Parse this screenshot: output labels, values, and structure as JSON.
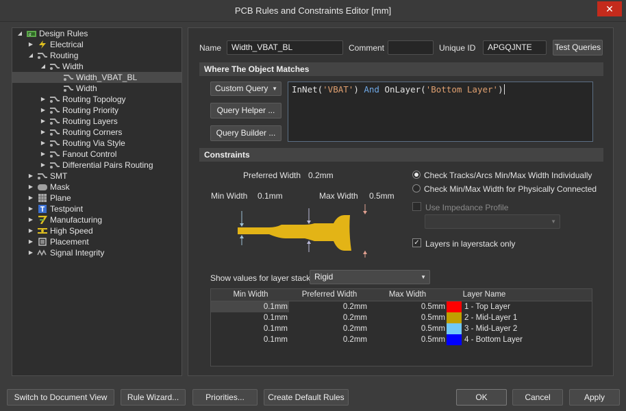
{
  "window": {
    "title": "PCB Rules and Constraints Editor [mm]"
  },
  "tree": {
    "items": [
      {
        "label": "Design Rules",
        "icon": "design-rules-icon"
      },
      {
        "label": "Electrical",
        "icon": "electrical-icon"
      },
      {
        "label": "Routing",
        "icon": "routing-icon"
      },
      {
        "label": "Width",
        "icon": "routing-icon"
      },
      {
        "label": "Width_VBAT_BL",
        "icon": "rule-icon"
      },
      {
        "label": "Width",
        "icon": "rule-icon"
      },
      {
        "label": "Routing Topology",
        "icon": "routing-icon"
      },
      {
        "label": "Routing Priority",
        "icon": "routing-icon"
      },
      {
        "label": "Routing Layers",
        "icon": "routing-icon"
      },
      {
        "label": "Routing Corners",
        "icon": "routing-icon"
      },
      {
        "label": "Routing Via Style",
        "icon": "routing-icon"
      },
      {
        "label": "Fanout Control",
        "icon": "routing-icon"
      },
      {
        "label": "Differential Pairs Routing",
        "icon": "routing-icon"
      },
      {
        "label": "SMT",
        "icon": "smt-icon"
      },
      {
        "label": "Mask",
        "icon": "mask-icon"
      },
      {
        "label": "Plane",
        "icon": "plane-icon"
      },
      {
        "label": "Testpoint",
        "icon": "testpoint-icon"
      },
      {
        "label": "Manufacturing",
        "icon": "manufacturing-icon"
      },
      {
        "label": "High Speed",
        "icon": "high-speed-icon"
      },
      {
        "label": "Placement",
        "icon": "placement-icon"
      },
      {
        "label": "Signal Integrity",
        "icon": "signal-integrity-icon"
      }
    ]
  },
  "rule": {
    "name_label": "Name",
    "name_value": "Width_VBAT_BL",
    "comment_label": "Comment",
    "comment_value": "",
    "uid_label": "Unique ID",
    "uid_value": "APGQJNTE",
    "test_queries": "Test Queries"
  },
  "match": {
    "header": "Where The Object Matches",
    "query_type": "Custom Query",
    "query_helper": "Query Helper ...",
    "query_builder": "Query Builder ...",
    "query_tokens": {
      "t1": "InNet(",
      "t2": "'VBAT'",
      "t3": ")",
      "t4": "And",
      "t5": "OnLayer(",
      "t6": "'Bottom Layer'",
      "t7": ")"
    }
  },
  "constraints": {
    "header": "Constraints",
    "preferred_width_label": "Preferred Width",
    "preferred_width_value": "0.2mm",
    "min_width_label": "Min Width",
    "min_width_value": "0.1mm",
    "max_width_label": "Max Width",
    "max_width_value": "0.5mm",
    "radio_individual": "Check Tracks/Arcs Min/Max Width Individually",
    "radio_connected": "Check Min/Max Width for Physically Connected",
    "use_impedance": "Use Impedance Profile",
    "layers_only": "Layers in layerstack only",
    "show_values_label": "Show values for layer stack",
    "layer_stack_value": "Rigid"
  },
  "grid": {
    "headers": [
      "Min Width",
      "Preferred Width",
      "Max Width",
      "Layer Name"
    ],
    "rows": [
      {
        "min": "0.1mm",
        "pref": "0.2mm",
        "max": "0.5mm",
        "layer": "1 - Top Layer",
        "color": "#ff0000"
      },
      {
        "min": "0.1mm",
        "pref": "0.2mm",
        "max": "0.5mm",
        "layer": "2 - Mid-Layer 1",
        "color": "#c0a000"
      },
      {
        "min": "0.1mm",
        "pref": "0.2mm",
        "max": "0.5mm",
        "layer": "3 - Mid-Layer 2",
        "color": "#70c8f8"
      },
      {
        "min": "0.1mm",
        "pref": "0.2mm",
        "max": "0.5mm",
        "layer": "4 - Bottom Layer",
        "color": "#0000ff"
      }
    ]
  },
  "footer": {
    "switch": "Switch to Document View",
    "wizard": "Rule Wizard...",
    "priorities": "Priorities...",
    "create_default": "Create Default Rules",
    "ok": "OK",
    "cancel": "Cancel",
    "apply": "Apply"
  },
  "colors": {
    "track": "#e3b416",
    "accent_border": "#5c6f85"
  }
}
